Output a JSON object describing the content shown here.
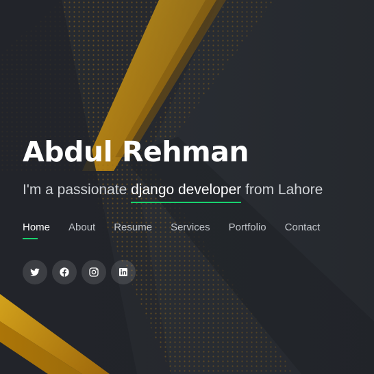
{
  "hero": {
    "name": "Abdul Rehman",
    "tagline_prefix": "I'm a passionate",
    "tagline_highlight": "django developer",
    "tagline_suffix": "from Lahore"
  },
  "nav": {
    "items": [
      {
        "label": "Home",
        "active": true
      },
      {
        "label": "About"
      },
      {
        "label": "Resume"
      },
      {
        "label": "Services"
      },
      {
        "label": "Portfolio"
      },
      {
        "label": "Contact"
      }
    ]
  },
  "social": {
    "icons": [
      "twitter-icon",
      "facebook-icon",
      "instagram-icon",
      "linkedin-icon"
    ]
  },
  "colors": {
    "accent": "#18d26e",
    "gold": "#f0a500",
    "background": "#26292e",
    "text": "#ffffff"
  }
}
